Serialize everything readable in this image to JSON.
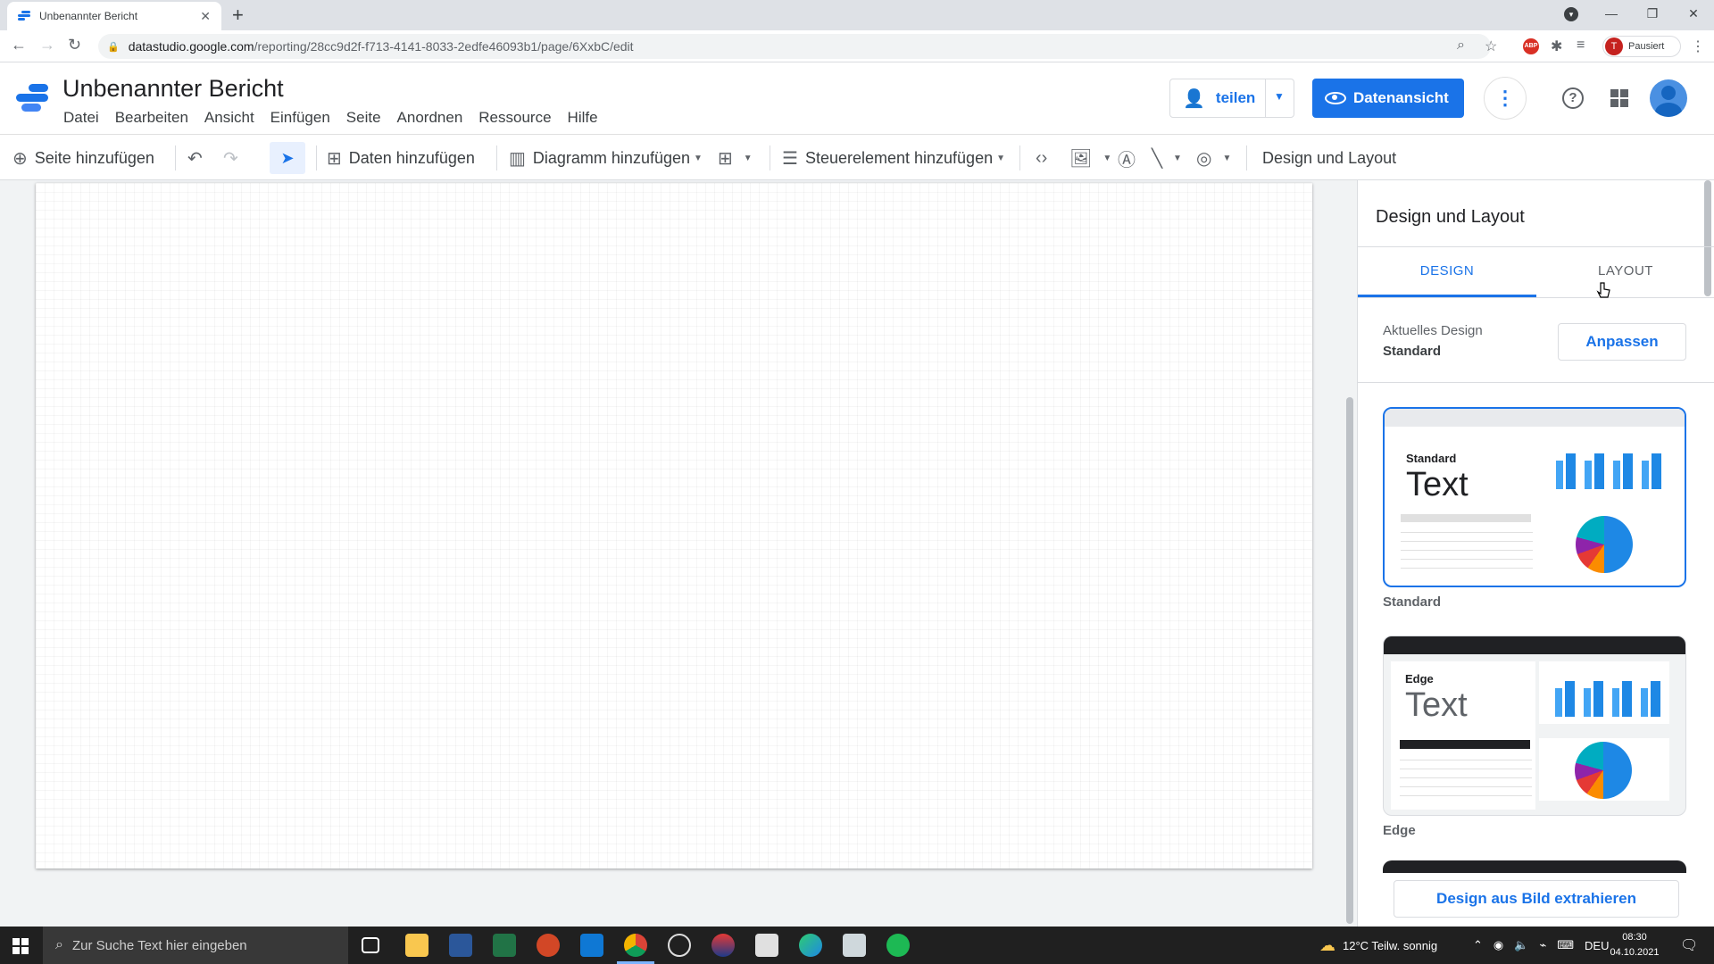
{
  "browser": {
    "tab_title": "Unbenannter Bericht",
    "url_host": "datastudio.google.com",
    "url_path": "/reporting/28cc9d2f-f713-4141-8033-2edfe46093b1/page/6XxbC/edit",
    "profile_initial": "T",
    "profile_status": "Pausiert",
    "adblock_label": "ABP"
  },
  "app": {
    "title": "Unbenannter Bericht",
    "menu": [
      "Datei",
      "Bearbeiten",
      "Ansicht",
      "Einfügen",
      "Seite",
      "Anordnen",
      "Ressource",
      "Hilfe"
    ],
    "share_label": "teilen",
    "view_label": "Datenansicht"
  },
  "toolbar": {
    "add_page": "Seite hinzufügen",
    "add_data": "Daten hinzufügen",
    "add_chart": "Diagramm hinzufügen",
    "add_control": "Steuerelement hinzufügen",
    "design_layout": "Design und Layout"
  },
  "panel": {
    "title": "Design und Layout",
    "tabs": [
      {
        "label": "DESIGN",
        "active": true
      },
      {
        "label": "LAYOUT",
        "active": false
      }
    ],
    "current_design_label": "Aktuelles Design",
    "current_design_value": "Standard",
    "adjust_button": "Anpassen",
    "themes": [
      {
        "name": "Standard",
        "preview_title": "Standard",
        "preview_text": "Text",
        "selected": true
      },
      {
        "name": "Edge",
        "preview_title": "Edge",
        "preview_text": "Text",
        "selected": false
      }
    ],
    "extract_button": "Design aus Bild extrahieren"
  },
  "taskbar": {
    "search_placeholder": "Zur Suche Text hier eingeben",
    "weather": "12°C  Teilw. sonnig",
    "language": "DEU",
    "time": "08:30",
    "date": "04.10.2021"
  },
  "colors": {
    "accent": "#1a73e8",
    "tab_strip": "#dee1e6",
    "taskbar": "#202020",
    "edge_header": "#202124"
  }
}
